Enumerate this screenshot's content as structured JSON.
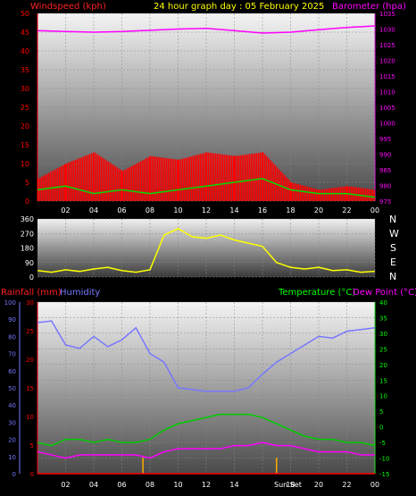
{
  "header": {
    "title": "24 hour graph day : 05 February 2025",
    "left_label": "Windspeed (kph)",
    "right_label": "Barometer (hpa)"
  },
  "colors": {
    "wind": "#ff0000",
    "gust_fill": "#ff0000",
    "avg": "#00dd00",
    "baro": "#ff00ff",
    "dir": "#ffff00",
    "temp": "#00cc00",
    "dew": "#ff00ff",
    "humidity": "#7777ff",
    "rain": "#ff0000",
    "axis_red": "#ff0000",
    "axis_green": "#00ff00"
  },
  "x_ticks": [
    "02",
    "04",
    "06",
    "08",
    "10",
    "12",
    "14",
    "16",
    "18",
    "20",
    "22",
    "00"
  ],
  "compass": [
    "N",
    "W",
    "S",
    "E",
    "N"
  ],
  "bottom_labels": {
    "rainfall": "Rainfall (mm)",
    "humidity": "Humidity",
    "temperature": "Temperature (°C)",
    "dewpoint": "Dew Point (°C)",
    "sunrise_sunset": "Sun Set"
  },
  "chart_data": [
    {
      "type": "line",
      "title": "24 hour graph day : 05 February 2025",
      "x_unit": "hour",
      "x_range": [
        0,
        24
      ],
      "left_axis": {
        "label": "Windspeed (kph)",
        "range": [
          0,
          50
        ],
        "ticks": [
          0,
          5,
          10,
          15,
          20,
          25,
          30,
          35,
          40,
          45,
          50
        ]
      },
      "right_axis": {
        "label": "Barometer (hpa)",
        "range": [
          975,
          1035
        ],
        "ticks": [
          975,
          980,
          985,
          990,
          995,
          1000,
          1005,
          1010,
          1015,
          1020,
          1025,
          1030,
          1035
        ]
      },
      "series": [
        {
          "name": "Barometer (hpa)",
          "axis": "right",
          "x": [
            0,
            2,
            4,
            6,
            8,
            10,
            12,
            14,
            16,
            18,
            20,
            22,
            24
          ],
          "y": [
            1029.5,
            1029.2,
            1029,
            1029.2,
            1029.6,
            1030,
            1030.2,
            1029.5,
            1028.7,
            1029,
            1029.8,
            1030.5,
            1031
          ]
        }
      ],
      "wind_avg": {
        "x": [
          0,
          2,
          4,
          6,
          8,
          10,
          12,
          14,
          16,
          18,
          20,
          22,
          24
        ],
        "y": [
          3,
          4,
          2,
          3,
          2,
          3,
          4,
          5,
          6,
          3,
          2,
          2,
          1
        ]
      },
      "wind_gust": {
        "x": [
          0,
          2,
          4,
          6,
          8,
          10,
          12,
          14,
          16,
          18,
          20,
          22,
          24
        ],
        "y": [
          6,
          10,
          13,
          8,
          12,
          11,
          13,
          12,
          13,
          5,
          3,
          4,
          3
        ]
      }
    },
    {
      "type": "scatter",
      "title": "",
      "x_range": [
        0,
        24
      ],
      "y_axis": {
        "range": [
          0,
          360
        ],
        "ticks": [
          0,
          90,
          180,
          270,
          360
        ]
      },
      "series": [
        {
          "name": "Wind direction",
          "x": [
            0,
            1,
            2,
            3,
            4,
            5,
            6,
            7,
            8,
            9,
            10,
            11,
            12,
            13,
            14,
            15,
            16,
            17,
            18,
            19,
            20,
            21,
            22,
            23,
            24
          ],
          "y": [
            40,
            30,
            45,
            35,
            50,
            60,
            40,
            30,
            45,
            260,
            300,
            250,
            240,
            260,
            230,
            210,
            190,
            90,
            60,
            50,
            60,
            40,
            45,
            30,
            35
          ]
        }
      ]
    },
    {
      "type": "line",
      "title": "",
      "x_range": [
        0,
        24
      ],
      "rain_axis": {
        "label": "Rainfall (mm)",
        "range": [
          0,
          30
        ],
        "ticks": [
          0,
          5,
          10,
          15,
          20,
          25,
          30
        ]
      },
      "humidity_axis": {
        "label": "Humidity",
        "range": [
          0,
          100
        ],
        "ticks": [
          0,
          10,
          20,
          30,
          40,
          50,
          60,
          70,
          80,
          90,
          100
        ]
      },
      "temp_axis": {
        "label": "Temperature (°C)",
        "range": [
          -15,
          40
        ],
        "ticks": [
          -15,
          -10,
          -5,
          0,
          5,
          10,
          15,
          20,
          25,
          30,
          35,
          40
        ]
      },
      "series": [
        {
          "name": "Humidity",
          "axis": "humidity",
          "x": [
            0,
            1,
            2,
            3,
            4,
            5,
            6,
            7,
            8,
            9,
            10,
            11,
            12,
            13,
            14,
            15,
            16,
            17,
            18,
            19,
            20,
            21,
            22,
            23,
            24
          ],
          "y": [
            88,
            89,
            75,
            73,
            80,
            74,
            78,
            85,
            70,
            65,
            50,
            49,
            48,
            48,
            48,
            50,
            58,
            65,
            70,
            75,
            80,
            79,
            83,
            84,
            85
          ]
        },
        {
          "name": "Temperature (°C)",
          "axis": "temp",
          "x": [
            0,
            1,
            2,
            3,
            4,
            5,
            6,
            7,
            8,
            9,
            10,
            11,
            12,
            13,
            14,
            15,
            16,
            17,
            18,
            19,
            20,
            21,
            22,
            23,
            24
          ],
          "y": [
            -5,
            -6,
            -4,
            -4,
            -5,
            -4,
            -5,
            -5,
            -4,
            -1,
            1,
            2,
            3,
            4,
            4,
            4,
            3,
            1,
            -1,
            -3,
            -4,
            -4,
            -5,
            -5,
            -6
          ]
        },
        {
          "name": "Dew Point (°C)",
          "axis": "temp",
          "x": [
            0,
            1,
            2,
            3,
            4,
            5,
            6,
            7,
            8,
            9,
            10,
            11,
            12,
            13,
            14,
            15,
            16,
            17,
            18,
            19,
            20,
            21,
            22,
            23,
            24
          ],
          "y": [
            -8,
            -9,
            -10,
            -9,
            -9,
            -9,
            -9,
            -9,
            -10,
            -8,
            -7,
            -7,
            -7,
            -7,
            -6,
            -6,
            -5,
            -6,
            -6,
            -7,
            -8,
            -8,
            -8,
            -9,
            -9
          ]
        },
        {
          "name": "Rainfall (mm)",
          "axis": "rain",
          "x": [
            0,
            24
          ],
          "y": [
            0,
            0
          ]
        }
      ],
      "markers": [
        {
          "x": 7.5,
          "label": ""
        },
        {
          "x": 17,
          "label": "Sun Set"
        }
      ]
    }
  ]
}
